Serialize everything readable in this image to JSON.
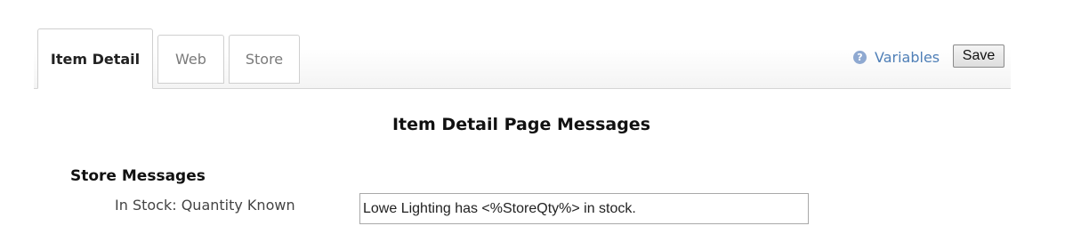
{
  "tabs": [
    {
      "label": "Item Detail",
      "active": true
    },
    {
      "label": "Web",
      "active": false
    },
    {
      "label": "Store",
      "active": false
    }
  ],
  "toolbar": {
    "help_icon_glyph": "?",
    "variables_label": "Variables",
    "save_label": "Save"
  },
  "main": {
    "title": "Item Detail Page Messages",
    "section_title": "Store Messages",
    "fields": [
      {
        "label": "In Stock: Quantity Known",
        "value": "Lowe Lighting has <%StoreQty%> in stock."
      }
    ]
  },
  "colors": {
    "link": "#4f7fb7",
    "help_icon": "#8fa9d1",
    "tab_border": "#cfcfcf"
  },
  "icons": {
    "help": "question-circle-icon"
  }
}
